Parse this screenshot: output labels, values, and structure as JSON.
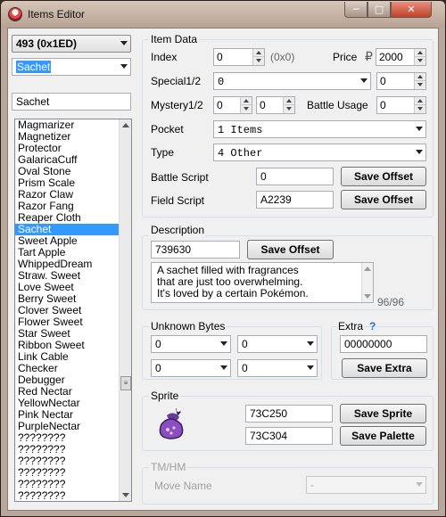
{
  "window": {
    "title": "Items Editor",
    "min": "─",
    "max": "□",
    "close": "✕"
  },
  "left": {
    "index_select": "493 (0x1ED)",
    "name_select": "Sachet",
    "name_field": "Sachet",
    "items": [
      "Magmarizer",
      "Magnetizer",
      "Protector",
      "GalaricaCuff",
      "Oval Stone",
      "Prism Scale",
      "Razor Claw",
      "Razor Fang",
      "Reaper Cloth",
      "Sachet",
      "Sweet Apple",
      "Tart Apple",
      "WhippedDream",
      "Straw. Sweet",
      "Love Sweet",
      "Berry Sweet",
      "Clover Sweet",
      "Flower Sweet",
      "Star Sweet",
      "Ribbon Sweet",
      "Link Cable",
      "Checker",
      "Debugger",
      "Red Nectar",
      "YellowNectar",
      "Pink Nectar",
      "PurpleNectar",
      "????????",
      "????????",
      "????????",
      "????????",
      "????????",
      "????????"
    ],
    "selected_index": 9
  },
  "item_data": {
    "heading": "Item Data",
    "index_label": "Index",
    "index_value": "0",
    "index_hex": "(0x0)",
    "price_label": "Price",
    "price_symbol": "₽",
    "price_value": "2000",
    "special_label": "Special1/2",
    "special1": "0",
    "special2": "0",
    "mystery_label": "Mystery1/2",
    "mystery1": "0",
    "mystery2": "0",
    "battle_usage_label": "Battle Usage",
    "battle_usage": "0",
    "pocket_label": "Pocket",
    "pocket_value": "1 Items",
    "type_label": "Type",
    "type_value": "4 Other",
    "battle_script_label": "Battle Script",
    "battle_script": "0",
    "field_script_label": "Field Script",
    "field_script": "A2239",
    "save_offset": "Save Offset"
  },
  "description": {
    "heading": "Description",
    "offset": "739630",
    "save_offset": "Save Offset",
    "line1": "A sachet filled with fragrances",
    "line2": "that are just too overwhelming.",
    "line3": "It's loved by a certain Pokémon.",
    "count": "96/96"
  },
  "unknown_bytes": {
    "heading": "Unknown Bytes",
    "b1": "0",
    "b2": "0",
    "b3": "0",
    "b4": "0"
  },
  "extra": {
    "heading": "Extra",
    "help": "?",
    "value": "00000000",
    "save": "Save Extra"
  },
  "sprite": {
    "heading": "Sprite",
    "offset1": "73C250",
    "offset2": "73C304",
    "save_sprite": "Save Sprite",
    "save_palette": "Save Palette"
  },
  "tmhm": {
    "heading": "TM/HM",
    "move_label": "Move Name",
    "move_value": "-"
  },
  "colors": {
    "selection": "#3399ff",
    "frame": "#b9a79c",
    "help": "#1e6fd0"
  }
}
